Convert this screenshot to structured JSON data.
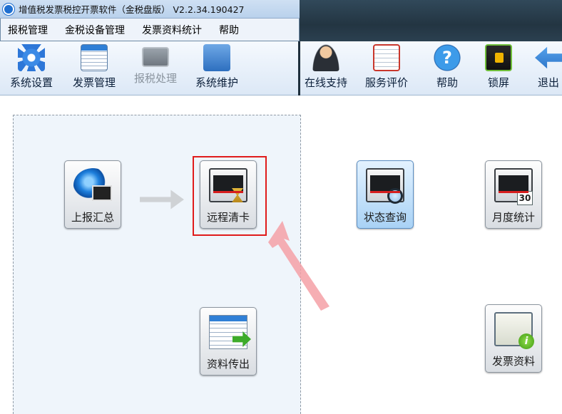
{
  "window": {
    "title": "增值税发票税控开票软件（金税盘版） V2.2.34.190427"
  },
  "menu": {
    "items": [
      "报税管理",
      "金税设备管理",
      "发票资料统计",
      "帮助"
    ]
  },
  "toolbar": {
    "left": [
      {
        "label": "系统设置",
        "icon": "gear-icon",
        "enabled": true
      },
      {
        "label": "发票管理",
        "icon": "invoice-icon",
        "enabled": true
      },
      {
        "label": "报税处理",
        "icon": "monitor-icon",
        "enabled": false
      },
      {
        "label": "系统维护",
        "icon": "folder-gear-icon",
        "enabled": true
      }
    ],
    "right": [
      {
        "label": "在线支持",
        "icon": "person-icon"
      },
      {
        "label": "服务评价",
        "icon": "clipboard-icon"
      },
      {
        "label": "帮助",
        "icon": "help-icon"
      },
      {
        "label": "锁屏",
        "icon": "lock-screen-icon"
      },
      {
        "label": "退出",
        "icon": "exit-arrow-icon"
      }
    ]
  },
  "functions": {
    "report_summary": "上报汇总",
    "remote_clear_card": "远程清卡",
    "status_query": "状态查询",
    "monthly_stats": "月度统计",
    "data_export": "资料传出",
    "invoice_data": "发票资料",
    "calendar_day": "30"
  },
  "colors": {
    "highlight_border": "#e01b1b",
    "annotation_arrow": "#f4a0a6",
    "panel_background": "#eff5fb"
  }
}
